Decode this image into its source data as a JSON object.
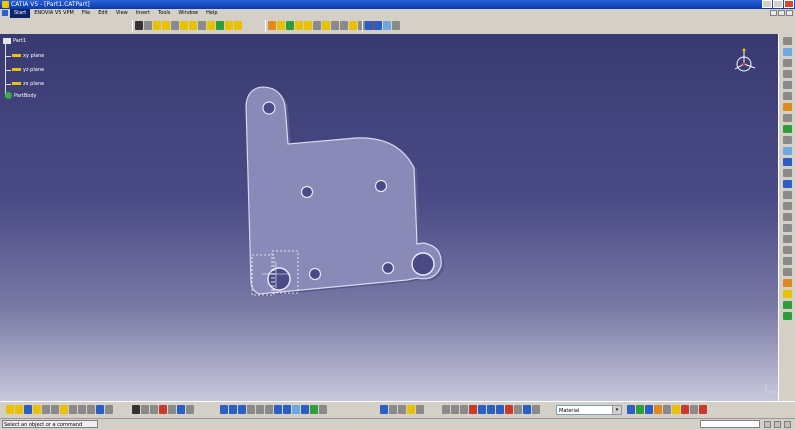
{
  "window": {
    "title": "CATIA V5 - [Part1.CATPart]"
  },
  "menu": {
    "items": [
      "Start",
      "ENOVIA V5 VPM",
      "File",
      "Edit",
      "View",
      "Insert",
      "Tools",
      "Window",
      "Help"
    ]
  },
  "spec_tree": {
    "root": "Part1",
    "planes": [
      "xy plane",
      "yz plane",
      "zx plane"
    ],
    "body": "PartBody"
  },
  "material": {
    "selected": "Material"
  },
  "status": {
    "message": "Select an object or a command"
  },
  "colors": {
    "viewport_top": "#3a3a72",
    "viewport_bottom": "#c8c8dc",
    "part_fill": "#8a8ab8",
    "part_edge": "#d8d8ee"
  }
}
